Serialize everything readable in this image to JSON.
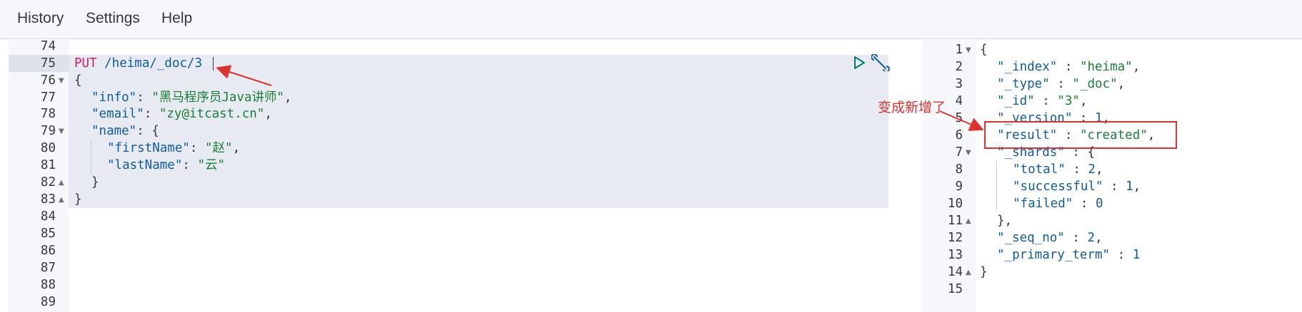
{
  "menu": {
    "items": [
      {
        "label": "History"
      },
      {
        "label": "Settings"
      },
      {
        "label": "Help"
      }
    ]
  },
  "request_editor": {
    "line_numbers": [
      "74",
      "75",
      "76",
      "77",
      "78",
      "79",
      "80",
      "81",
      "82",
      "83",
      "84",
      "85",
      "86",
      "87",
      "88",
      "89"
    ],
    "method": "PUT",
    "path": " /heima/_doc/3",
    "body": {
      "open": "{",
      "info_key": "\"info\"",
      "info_val": "\"黑马程序员Java讲师\"",
      "email_key": "\"email\"",
      "email_val": "\"zy@itcast.cn\"",
      "name_key": "\"name\"",
      "name_open": "{",
      "first_key": "\"firstName\"",
      "first_val": "\"赵\"",
      "last_key": "\"lastName\"",
      "last_val": "\"云\"",
      "name_close": "}",
      "close": "}"
    },
    "colon": ":",
    "comma": ","
  },
  "response_viewer": {
    "line_numbers": [
      "1",
      "2",
      "3",
      "4",
      "5",
      "6",
      "7",
      "8",
      "9",
      "10",
      "11",
      "12",
      "13",
      "14",
      "15"
    ],
    "open": "{",
    "index_key": "\"_index\"",
    "index_val": "\"heima\"",
    "type_key": "\"_type\"",
    "type_val": "\"_doc\"",
    "id_key": "\"_id\"",
    "id_val": "\"3\"",
    "version_key": "\"_version\"",
    "version_val": "1",
    "result_key": "\"result\"",
    "result_val": "\"created\"",
    "shards_key": "\"_shards\"",
    "shards_open": "{",
    "total_key": "\"total\"",
    "total_val": "2",
    "successful_key": "\"successful\"",
    "successful_val": "1",
    "failed_key": "\"failed\"",
    "failed_val": "0",
    "shards_close": "},",
    "seq_key": "\"_seq_no\"",
    "seq_val": "2",
    "term_key": "\"_primary_term\"",
    "term_val": "1",
    "close": "}"
  },
  "annotations": {
    "changed_label": "变成新增了",
    "color": "#e03131"
  },
  "icons": {
    "run": "play-icon",
    "settings": "wrench-icon"
  }
}
